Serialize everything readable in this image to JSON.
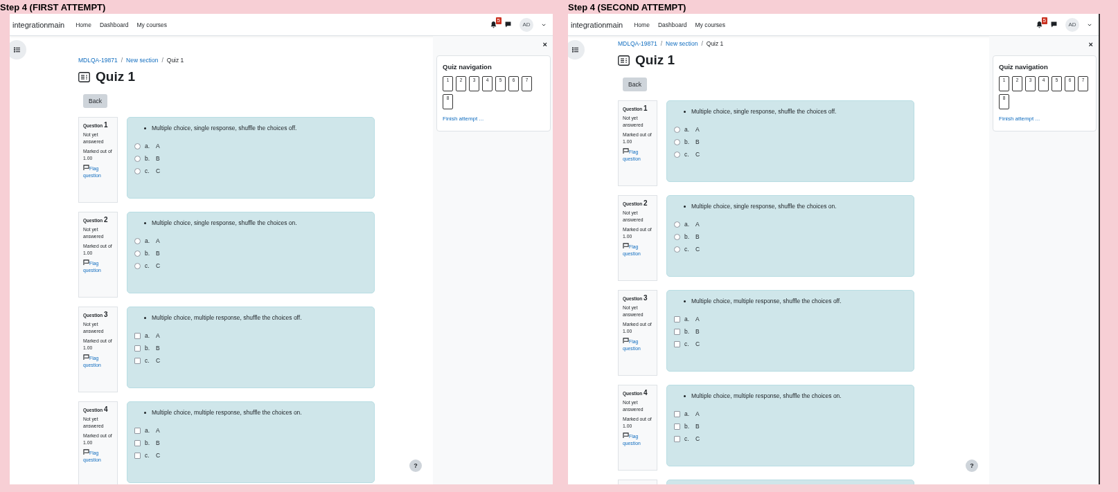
{
  "screenshots": [
    {
      "caption": "Step 4 (FIRST ATTEMPT)",
      "scrolled": false,
      "navbar": {
        "brand": "integrationmain",
        "links": [
          "Home",
          "Dashboard",
          "My courses"
        ],
        "notification_count": "5",
        "avatar": "AD"
      },
      "breadcrumb": [
        {
          "text": "MDLQA-19871"
        },
        {
          "separator": "/",
          "text": "New section"
        },
        {
          "separator": "/",
          "text": "Quiz 1"
        }
      ],
      "title": "Quiz 1",
      "back": "Back",
      "questions": [
        {
          "label": "Question",
          "number": "1",
          "status": "Not yet answered",
          "marks": "Marked out of 1.00",
          "flag": "Flag question",
          "text": "Multiple choice, single response, shuffle the choices off.",
          "kind": "single",
          "options": [
            {
              "letter": "a.",
              "text": "A",
              "selected": false
            },
            {
              "letter": "b.",
              "text": "B",
              "selected": false
            },
            {
              "letter": "c.",
              "text": "C",
              "selected": false
            }
          ]
        },
        {
          "label": "Question",
          "number": "2",
          "status": "Not yet answered",
          "marks": "Marked out of 1.00",
          "flag": "Flag question",
          "text": "Multiple choice, single response, shuffle the choices on.",
          "kind": "single",
          "options": [
            {
              "letter": "a.",
              "text": "A",
              "selected": false
            },
            {
              "letter": "b.",
              "text": "B",
              "selected": false
            },
            {
              "letter": "c.",
              "text": "C",
              "selected": false
            }
          ]
        },
        {
          "label": "Question",
          "number": "3",
          "status": "Not yet answered",
          "marks": "Marked out of 1.00",
          "flag": "Flag question",
          "text": "Multiple choice, multiple response, shuffle the choices off.",
          "kind": "multiple",
          "options": [
            {
              "letter": "a.",
              "text": "A",
              "selected": false
            },
            {
              "letter": "b.",
              "text": "B",
              "selected": false
            },
            {
              "letter": "c.",
              "text": "C",
              "selected": false
            }
          ]
        },
        {
          "label": "Question",
          "number": "4",
          "status": "Not yet answered",
          "marks": "Marked out of 1.00",
          "flag": "Flag question",
          "text": "Multiple choice, multiple response, shuffle the choices on.",
          "kind": "multiple",
          "options": [
            {
              "letter": "a.",
              "text": "A",
              "selected": false
            },
            {
              "letter": "b.",
              "text": "B",
              "selected": false
            },
            {
              "letter": "c.",
              "text": "C",
              "selected": false
            }
          ]
        }
      ],
      "drawer_close": "×",
      "quiz_navigation": {
        "title": "Quiz navigation",
        "buttons": [
          "1",
          "2",
          "3",
          "4",
          "5",
          "6",
          "7",
          "8"
        ],
        "finish": "Finish attempt ..."
      },
      "help": "?"
    },
    {
      "caption": "Step 4 (SECOND ATTEMPT)",
      "scrolled": true,
      "more_below": true,
      "navbar": {
        "brand": "integrationmain",
        "links": [
          "Home",
          "Dashboard",
          "My courses"
        ],
        "notification_count": "5",
        "avatar": "AD"
      },
      "breadcrumb": [
        {
          "text": "MDLQA-19871"
        },
        {
          "separator": "/",
          "text": "New section"
        },
        {
          "separator": "/",
          "text": "Quiz 1"
        }
      ],
      "title": "Quiz 1",
      "back": "Back",
      "questions": [
        {
          "label": "Question",
          "number": "1",
          "status": "Not yet answered",
          "marks": "Marked out of 1.00",
          "flag": "Flag question",
          "text": "Multiple choice, single response, shuffle the choices off.",
          "kind": "single",
          "options": [
            {
              "letter": "a.",
              "text": "A",
              "selected": false
            },
            {
              "letter": "b.",
              "text": "B",
              "selected": false
            },
            {
              "letter": "c.",
              "text": "C",
              "selected": false
            }
          ]
        },
        {
          "label": "Question",
          "number": "2",
          "status": "Not yet answered",
          "marks": "Marked out of 1.00",
          "flag": "Flag question",
          "text": "Multiple choice, single response, shuffle the choices on.",
          "kind": "single",
          "options": [
            {
              "letter": "a.",
              "text": "A",
              "selected": false
            },
            {
              "letter": "b.",
              "text": "B",
              "selected": false
            },
            {
              "letter": "c.",
              "text": "C",
              "selected": false
            }
          ]
        },
        {
          "label": "Question",
          "number": "3",
          "status": "Not yet answered",
          "marks": "Marked out of 1.00",
          "flag": "Flag question",
          "text": "Multiple choice, multiple response, shuffle the choices off.",
          "kind": "multiple",
          "options": [
            {
              "letter": "a.",
              "text": "A",
              "selected": false
            },
            {
              "letter": "b.",
              "text": "B",
              "selected": false
            },
            {
              "letter": "c.",
              "text": "C",
              "selected": false
            }
          ]
        },
        {
          "label": "Question",
          "number": "4",
          "status": "Not yet answered",
          "marks": "Marked out of 1.00",
          "flag": "Flag question",
          "text": "Multiple choice, multiple response, shuffle the choices on.",
          "kind": "multiple",
          "options": [
            {
              "letter": "a.",
              "text": "A",
              "selected": false
            },
            {
              "letter": "b.",
              "text": "B",
              "selected": false
            },
            {
              "letter": "c.",
              "text": "C",
              "selected": false
            }
          ]
        }
      ],
      "drawer_close": "×",
      "quiz_navigation": {
        "title": "Quiz navigation",
        "buttons": [
          "1",
          "2",
          "3",
          "4",
          "5",
          "6",
          "7",
          "8"
        ],
        "finish": "Finish attempt ..."
      },
      "help": "?"
    }
  ]
}
